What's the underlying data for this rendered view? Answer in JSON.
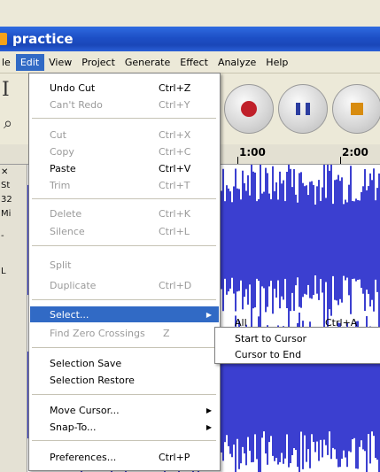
{
  "window": {
    "title": "practice"
  },
  "menubar": {
    "items": [
      {
        "label": "le",
        "active": false
      },
      {
        "label": "Edit",
        "active": true
      },
      {
        "label": "View",
        "active": false
      },
      {
        "label": "Project",
        "active": false
      },
      {
        "label": "Generate",
        "active": false
      },
      {
        "label": "Effect",
        "active": false
      },
      {
        "label": "Analyze",
        "active": false
      },
      {
        "label": "Help",
        "active": false
      }
    ]
  },
  "ruler": {
    "labels": [
      "1:00",
      "2:00"
    ]
  },
  "track_panel": {
    "fragments": [
      "St",
      "32",
      "Mi",
      "-",
      "L"
    ]
  },
  "edit_menu": {
    "undo": {
      "label": "Undo Cut",
      "shortcut": "Ctrl+Z"
    },
    "redo": {
      "label": "Can't Redo",
      "shortcut": "Ctrl+Y"
    },
    "cut": {
      "label": "Cut",
      "shortcut": "Ctrl+X"
    },
    "copy": {
      "label": "Copy",
      "shortcut": "Ctrl+C"
    },
    "paste": {
      "label": "Paste",
      "shortcut": "Ctrl+V"
    },
    "trim": {
      "label": "Trim",
      "shortcut": "Ctrl+T"
    },
    "delete": {
      "label": "Delete",
      "shortcut": "Ctrl+K"
    },
    "silence": {
      "label": "Silence",
      "shortcut": "Ctrl+L"
    },
    "split": {
      "label": "Split",
      "shortcut": ""
    },
    "duplicate": {
      "label": "Duplicate",
      "shortcut": "Ctrl+D"
    },
    "select": {
      "label": "Select...",
      "shortcut": ""
    },
    "find_zero": {
      "label": "Find Zero Crossings",
      "shortcut": "Z"
    },
    "selection_save": {
      "label": "Selection Save",
      "shortcut": ""
    },
    "selection_restore": {
      "label": "Selection Restore",
      "shortcut": ""
    },
    "move_cursor": {
      "label": "Move Cursor...",
      "shortcut": ""
    },
    "snap_to": {
      "label": "Snap-To...",
      "shortcut": ""
    },
    "preferences": {
      "label": "Preferences...",
      "shortcut": "Ctrl+P"
    }
  },
  "select_submenu": {
    "all": {
      "label": "All",
      "shortcut": "Ctrl+A"
    },
    "start_to_cursor": {
      "label": "Start to Cursor"
    },
    "cursor_to_end": {
      "label": "Cursor to End"
    }
  },
  "colors": {
    "titlebar": "#1d4fc6",
    "highlight": "#316ac5",
    "waveform": "#3b3fd0",
    "record": "#c0202a",
    "pause": "#2c3da0",
    "stop": "#d88c10"
  }
}
